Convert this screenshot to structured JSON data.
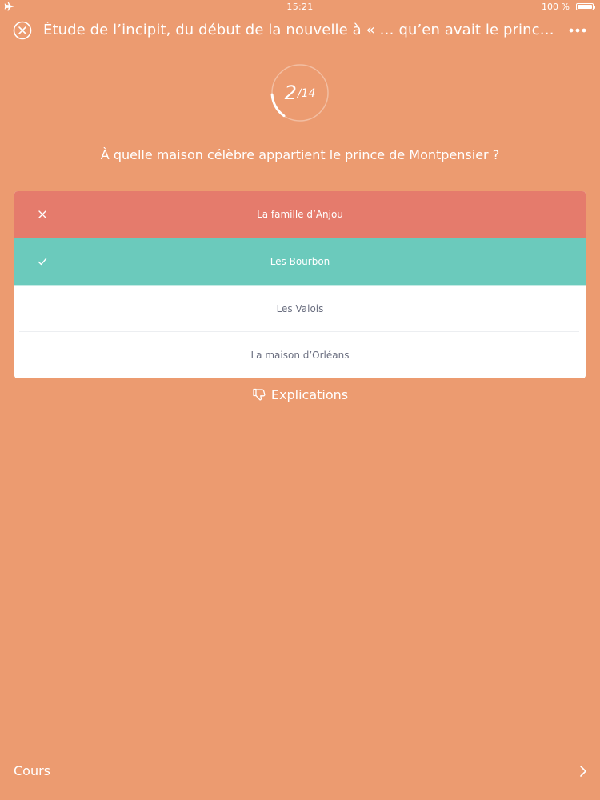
{
  "status_bar": {
    "time": "15:21",
    "battery_label": "100 %",
    "battery_level": 1.0
  },
  "nav": {
    "title": "Étude de l’incipit, du début de la nouvelle à « … qu’en avait le prince son m…",
    "close_icon": "close-circle-icon",
    "more_icon": "ellipsis-icon"
  },
  "progress": {
    "current": "2",
    "separator": "/",
    "total": "14",
    "fraction": 0.143
  },
  "question": {
    "text": "À quelle maison célèbre appartient le prince de Montpensier ?"
  },
  "answers": [
    {
      "label": "La famille d’Anjou",
      "state": "wrong",
      "icon": "cross-icon"
    },
    {
      "label": "Les Bourbon",
      "state": "correct",
      "icon": "check-icon"
    },
    {
      "label": "Les Valois",
      "state": "neutral"
    },
    {
      "label": "La maison d’Orléans",
      "state": "neutral"
    }
  ],
  "explanations": {
    "label": "Explications",
    "icon": "thumbs-down-icon"
  },
  "bottom": {
    "label": "Cours",
    "icon": "chevron-right-icon"
  },
  "colors": {
    "background": "#ec9b70",
    "wrong": "#e57b6c",
    "correct": "#6bcabc",
    "neutral_text": "#6b6f80"
  }
}
